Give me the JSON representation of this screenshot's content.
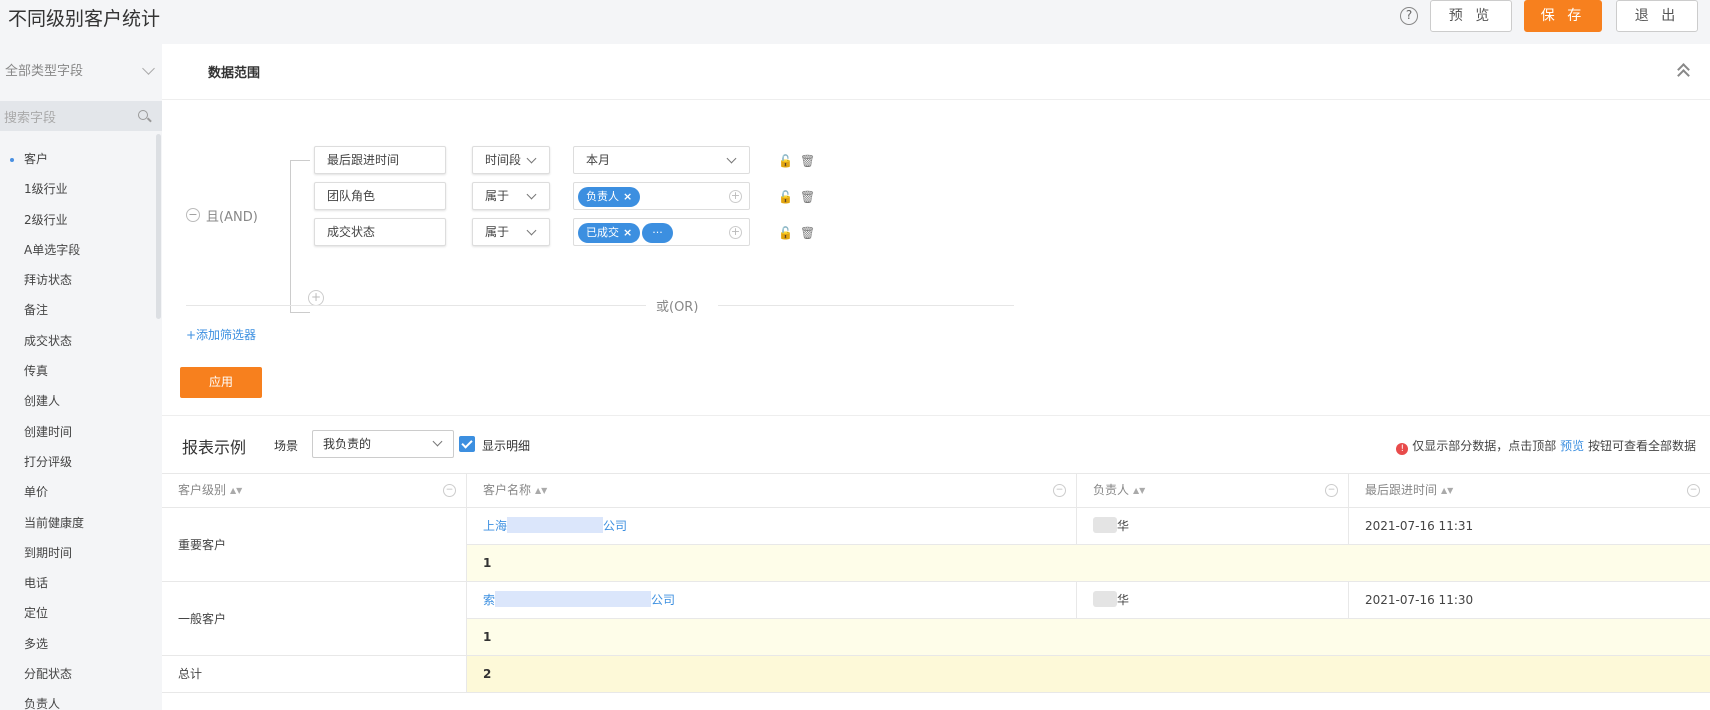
{
  "header": {
    "title": "不同级别客户统计",
    "help": "?",
    "preview_label": "预 览",
    "save_label": "保 存",
    "exit_label": "退 出"
  },
  "sidebar": {
    "type_select": "全部类型字段",
    "search_placeholder": "搜索字段",
    "items": [
      "客户",
      "1级行业",
      "2级行业",
      "A单选字段",
      "拜访状态",
      "备注",
      "成交状态",
      "传真",
      "创建人",
      "创建时间",
      "打分评级",
      "单价",
      "当前健康度",
      "到期时间",
      "电话",
      "定位",
      "多选",
      "分配状态",
      "负责人"
    ]
  },
  "filter": {
    "section_title": "数据范围",
    "and_label": "且(AND)",
    "or_label": "或(OR)",
    "add_filter": "+添加筛选器",
    "apply": "应用",
    "conditions": [
      {
        "field": "最后跟进时间",
        "op": "时间段",
        "value": "本月"
      },
      {
        "field": "团队角色",
        "op": "属于",
        "tags": [
          "负责人"
        ]
      },
      {
        "field": "成交状态",
        "op": "属于",
        "tags": [
          "已成交"
        ],
        "more": "···"
      }
    ]
  },
  "report": {
    "title": "报表示例",
    "scene_label": "场景",
    "scene_value": "我负责的",
    "show_detail": "显示明细",
    "notice_prefix": "仅显示部分数据，点击顶部",
    "notice_link": "预览",
    "notice_suffix": "按钮可查看全部数据",
    "columns": [
      "客户级别",
      "客户名称",
      "负责人",
      "最后跟进时间"
    ],
    "groups": [
      {
        "level": "重要客户",
        "name_start": "上海",
        "name_end": "公司",
        "owner_end": "华",
        "time": "2021-07-16 11:31",
        "subtotal": "1"
      },
      {
        "level": "一般客户",
        "name_start": "索",
        "name_end": "公司",
        "owner_end": "华",
        "time": "2021-07-16 11:30",
        "subtotal": "1"
      }
    ],
    "total_label": "总计",
    "total_value": "2"
  },
  "colors": {
    "accent": "#f7801e",
    "link": "#3c8fe0"
  }
}
